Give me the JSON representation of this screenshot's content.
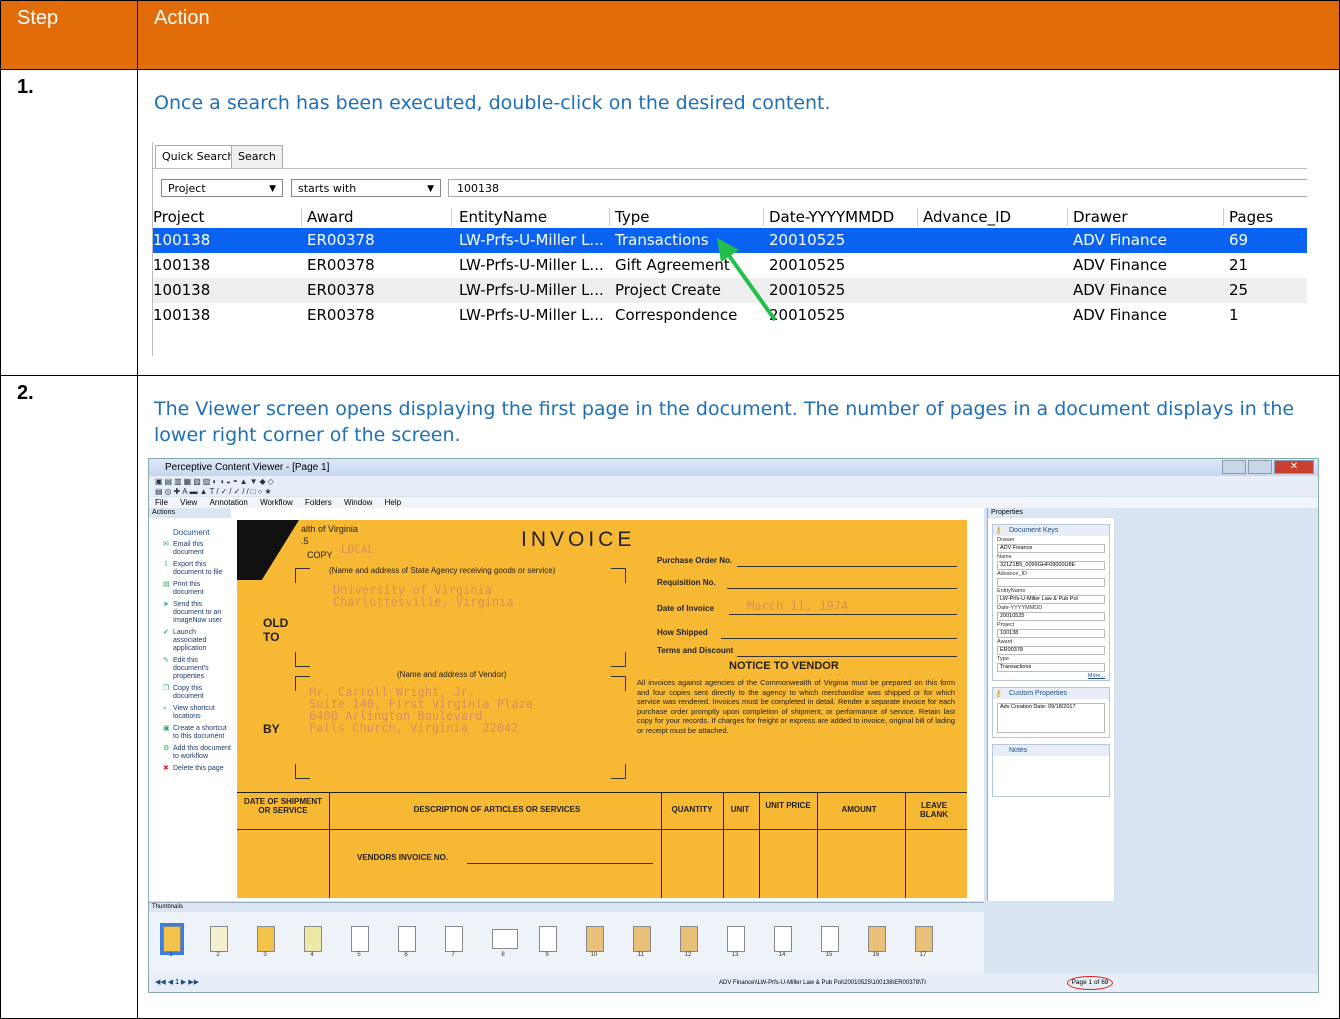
{
  "table": {
    "header_step": "Step",
    "header_action": "Action",
    "header_color": "#e36c0a"
  },
  "rows": [
    {
      "step": "1.",
      "instruction": "Once a search has been executed, double-click on the desired content."
    },
    {
      "step": "2.",
      "instruction": "The Viewer screen opens displaying the first page in the document.  The number of pages in a document displays in the lower right corner of the screen."
    }
  ],
  "search": {
    "tabs": [
      "Quick Search",
      "Search"
    ],
    "field_select": "Project",
    "operator_select": "starts with",
    "value": "100138",
    "columns": [
      "Project",
      "Award",
      "EntityName",
      "Type",
      "Date-YYYYMMDD",
      "Advance_ID",
      "Drawer",
      "Pages"
    ],
    "results": [
      [
        "100138",
        "ER00378",
        "LW-Prfs-U-Miller L...",
        "Transactions",
        "20010525",
        "",
        "ADV Finance",
        "69"
      ],
      [
        "100138",
        "ER00378",
        "LW-Prfs-U-Miller L...",
        "Gift Agreement",
        "20010525",
        "",
        "ADV Finance",
        "21"
      ],
      [
        "100138",
        "ER00378",
        "LW-Prfs-U-Miller L...",
        "Project Create",
        "20010525",
        "",
        "ADV Finance",
        "25"
      ],
      [
        "100138",
        "ER00378",
        "LW-Prfs-U-Miller L...",
        "Correspondence",
        "20010525",
        "",
        "ADV Finance",
        "1"
      ]
    ],
    "selected_color": "#0a62f3",
    "arrow_color": "#22c04a"
  },
  "viewer": {
    "window_title": "Perceptive Content Viewer - [Page 1]",
    "menu": [
      "File",
      "View",
      "Annotation",
      "Workflow",
      "Folders",
      "Window",
      "Help"
    ],
    "actions_panel_title": "Actions",
    "actions_group": "Document",
    "actions": [
      "Email this document",
      "Export this document to file",
      "Print this document",
      "Send this document to an ImageNow user",
      "Launch associated application",
      "Edit this document's properties",
      "Copy this document",
      "View shortcut locations",
      "Create a shortcut to this document",
      "Add this document to workflow",
      "Delete this page"
    ],
    "invoice": {
      "title": "INVOICE",
      "state": "alth of Virginia",
      "five": ".5",
      "copy": "COPY",
      "local": "LOCAL",
      "agency_label": "(Name and address of State Agency receiving goods or service)",
      "agency_typed": "University of Virginia\nCharlottesville, Virginia",
      "sold": "OLD",
      "to": "TO",
      "by": "BY",
      "vendor_label": "(Name and address of Vendor)",
      "vendor_typed": "Mr. Carroll Wright, Jr.\nSuite 140, First Virginia Plaza\n6400 Arlington Boulevard\nFalls Church, Virginia  22042",
      "purchase_order": "Purchase Order No.",
      "requisition": "Requisition No.",
      "date_of_invoice": "Date of Invoice",
      "date_typed": "March 11, 1974",
      "how_shipped": "How Shipped",
      "terms": "Terms and Discount",
      "notice_title": "NOTICE TO VENDOR",
      "notice_body": "All invoices against agencies of the Commonwealth of Virginia must be prepared on this form and four copies sent directly to the agency to which merchandise was shipped or for which service was rendered. Invoices must be completed in detail. Render a separate invoice for each purchase order promptly upon completion of shipment, or performance of service. Retain last copy for your records. If charges for freight or express are added to invoice, original bill of lading or receipt must be attached.",
      "col_date": "DATE OF SHIPMENT OR SERVICE",
      "col_desc": "DESCRIPTION OF ARTICLES OR SERVICES",
      "col_qty": "QUANTITY",
      "col_unit": "UNIT",
      "col_price": "UNIT PRICE",
      "col_amount": "AMOUNT",
      "col_blank": "LEAVE BLANK",
      "vendors_invoice": "VENDORS INVOICE NO."
    },
    "properties": {
      "panel_title": "Properties",
      "keys_title": "Document Keys",
      "drawer_label": "Drawer",
      "drawer": "ADV Finance",
      "name_label": "Name",
      "name": "321Z1B5_0099GHF09000U8E",
      "advance_label": "Advance_ID",
      "advance": "",
      "entity_label": "EntityName",
      "entity": "LW-Prfs-U-Miller Law & Pub Pol",
      "date_label": "Date-YYYYMMDD",
      "date": "20010525",
      "project_label": "Project",
      "project": "100138",
      "award_label": "Award",
      "award": "ER00378",
      "type_label": "Type",
      "type": "Transactions",
      "more": "More...",
      "custom_title": "Custom Properties",
      "custom_value": "Adv Creation Date: 09/18/2017",
      "notes_title": "Notes"
    },
    "thumbnails_title": "Thumbnails",
    "thumbnail_numbers": [
      "1",
      "2",
      "3",
      "4",
      "5",
      "6",
      "7",
      "8",
      "9",
      "10",
      "11",
      "12",
      "13",
      "14",
      "15",
      "16",
      "17"
    ],
    "page_nav": "1",
    "status_path": "ADV Finance\\\\LW-Prfs-U-Miller Law & Pub Pol\\20010525\\100138\\ER00378\\Tr",
    "page_count": "Page 1 of 69"
  }
}
